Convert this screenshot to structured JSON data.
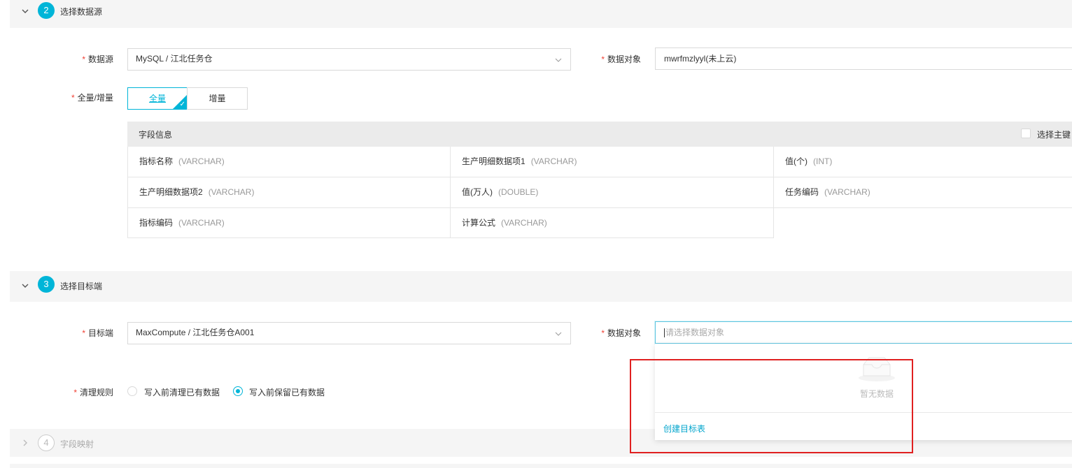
{
  "section2": {
    "step": "2",
    "title": "选择数据源"
  },
  "source": {
    "datasource_label": "数据源",
    "datasource_value": "MySQL / 江北任务仓",
    "object_label": "数据对象",
    "object_value": "mwrfmzlyyl(未上云)",
    "mode_label": "全量/增量",
    "mode_full": "全量",
    "mode_incremental": "增量",
    "selected_mode": "全量"
  },
  "fields": {
    "header": "字段信息",
    "pk_checkbox_label": "选择主键",
    "rows": [
      [
        {
          "name": "指标名称",
          "type": "(VARCHAR)"
        },
        {
          "name": "生产明细数据项1",
          "type": "(VARCHAR)"
        },
        {
          "name": "值(个)",
          "type": "(INT)"
        }
      ],
      [
        {
          "name": "生产明细数据项2",
          "type": "(VARCHAR)"
        },
        {
          "name": "值(万人)",
          "type": "(DOUBLE)"
        },
        {
          "name": "任务编码",
          "type": "(VARCHAR)"
        }
      ],
      [
        {
          "name": "指标编码",
          "type": "(VARCHAR)"
        },
        {
          "name": "计算公式",
          "type": "(VARCHAR)"
        }
      ]
    ]
  },
  "section3": {
    "step": "3",
    "title": "选择目标端"
  },
  "target": {
    "target_label": "目标端",
    "target_value": "MaxCompute / 江北任务仓A001",
    "object_label": "数据对象",
    "object_placeholder": "请选择数据对象",
    "clean_label": "清理规则",
    "clean_options": [
      "写入前清理已有数据",
      "写入前保留已有数据"
    ],
    "clean_selected": "写入前保留已有数据"
  },
  "dropdown": {
    "empty_text": "暂无数据",
    "create_link": "创建目标表"
  },
  "section4": {
    "step": "4",
    "title": "字段映射"
  },
  "colors": {
    "accent": "#00b5d8",
    "required": "#f04134",
    "highlight": "#e02020"
  }
}
